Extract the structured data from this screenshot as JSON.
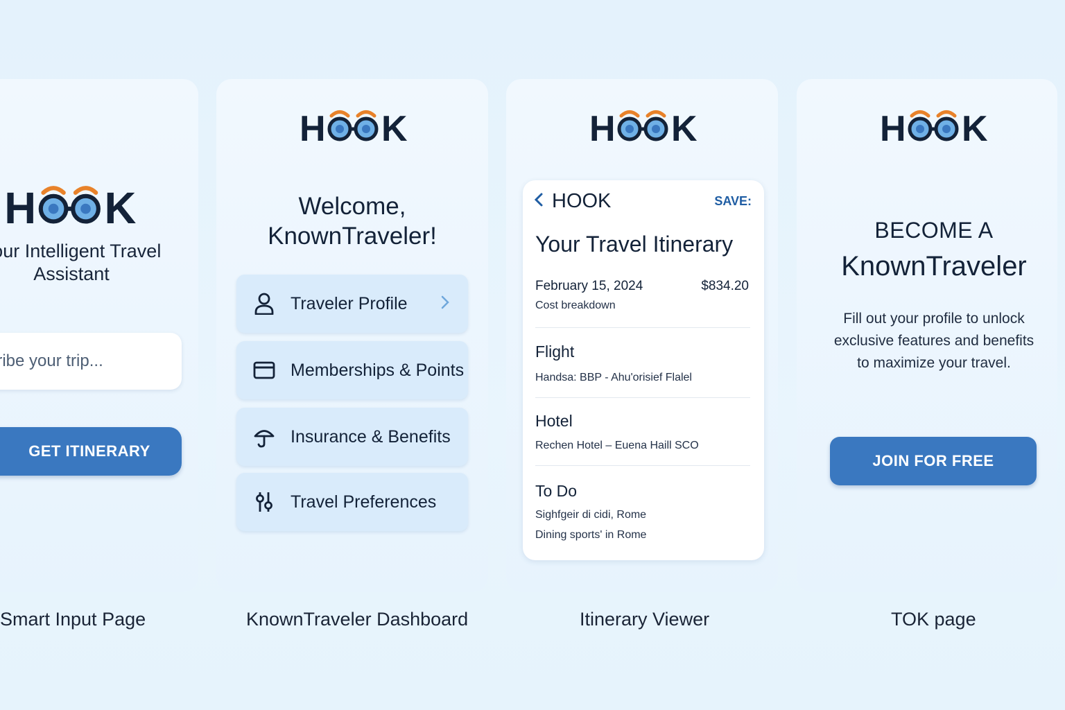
{
  "brand": {
    "logo_text": "HOOK",
    "colors": {
      "navy": "#132238",
      "orange": "#e8822a",
      "lens_blue": "#6fb0e6",
      "button_blue": "#3a78c0",
      "accent_link": "#1f5da3",
      "menu_bg": "#d9ebfb"
    }
  },
  "smart_input": {
    "tagline": "Your Intelligent Travel Assistant",
    "input_placeholder": "escribe your trip...",
    "button_label": "GET ITINERARY",
    "caption": "Smart Input Page"
  },
  "dashboard": {
    "welcome_line1": "Welcome,",
    "welcome_line2": "KnownTraveler!",
    "menu": [
      {
        "label": "Traveler Profile",
        "icon": "person-icon"
      },
      {
        "label": "Memberships & Points",
        "icon": "card-icon"
      },
      {
        "label": "Insurance & Benefits",
        "icon": "umbrella-icon"
      },
      {
        "label": "Travel Preferences",
        "icon": "sliders-icon"
      }
    ],
    "caption": "KnownTraveler Dashboard"
  },
  "itinerary": {
    "header_title": "HOOK",
    "save_label": "SAVE:",
    "title": "Your Travel Itinerary",
    "date": "February 15, 2024",
    "price": "$834.20",
    "cost_label": "Cost breakdown",
    "sections": [
      {
        "heading": "Flight",
        "lines": [
          "Handsa: BBP - Ahu'orisief Flalel"
        ]
      },
      {
        "heading": "Hotel",
        "lines": [
          "Rechen Hotel – Euena Haill SCO"
        ]
      },
      {
        "heading": "To Do",
        "lines": [
          "Sighfgeir  di cidi, Rome",
          "Dining sports' in Rome"
        ]
      }
    ],
    "caption": "Itinerary Viewer"
  },
  "tok": {
    "become": "BECOME A",
    "known": "KnownTraveler",
    "description_lines": [
      "Fill out your profile to unlock",
      "exclusive features and benefits",
      "to maximize your travel."
    ],
    "button_label": "JOIN FOR FREE",
    "caption": "TOK page"
  }
}
